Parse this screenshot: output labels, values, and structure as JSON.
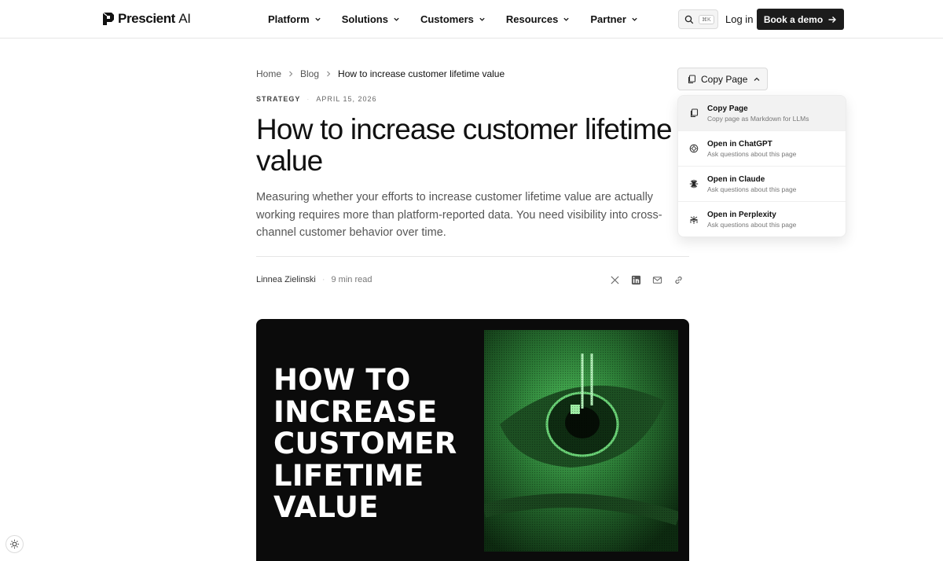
{
  "brand": {
    "name": "Prescient",
    "name_suffix": "AI"
  },
  "nav": {
    "items": [
      {
        "label": "Platform"
      },
      {
        "label": "Solutions"
      },
      {
        "label": "Customers"
      },
      {
        "label": "Resources"
      },
      {
        "label": "Partner"
      }
    ]
  },
  "header": {
    "search_shortcut": "⌘K",
    "login_label": "Log in",
    "demo_label": "Book a demo"
  },
  "breadcrumb": {
    "home": "Home",
    "blog": "Blog",
    "current": "How to increase customer lifetime value"
  },
  "article": {
    "category": "STRATEGY",
    "date": "APRIL 15, 2026",
    "title": "How to increase customer lifetime value",
    "lede": "Measuring whether your efforts to increase customer lifetime value are actually working requires more than platform-reported data. You need visibility into cross-channel customer behavior over time.",
    "author": "Linnea Zielinski",
    "read_time": "9 min read"
  },
  "copy_page": {
    "button_label": "Copy Page",
    "menu": [
      {
        "title": "Copy Page",
        "subtitle": "Copy page as Markdown for LLMs",
        "icon": "copy-icon"
      },
      {
        "title": "Open in ChatGPT",
        "subtitle": "Ask questions about this page",
        "icon": "chatgpt-icon"
      },
      {
        "title": "Open in Claude",
        "subtitle": "Ask questions about this page",
        "icon": "claude-icon"
      },
      {
        "title": "Open in Perplexity",
        "subtitle": "Ask questions about this page",
        "icon": "perplexity-icon"
      }
    ]
  },
  "hero": {
    "lines": [
      "HOW TO",
      "INCREASE",
      "CUSTOMER",
      "LIFETIME",
      "VALUE"
    ]
  },
  "colors": {
    "accent_dark": "#1c1c1c",
    "hero_bg": "#0b0b0b",
    "hero_green": "#3aa64a"
  }
}
